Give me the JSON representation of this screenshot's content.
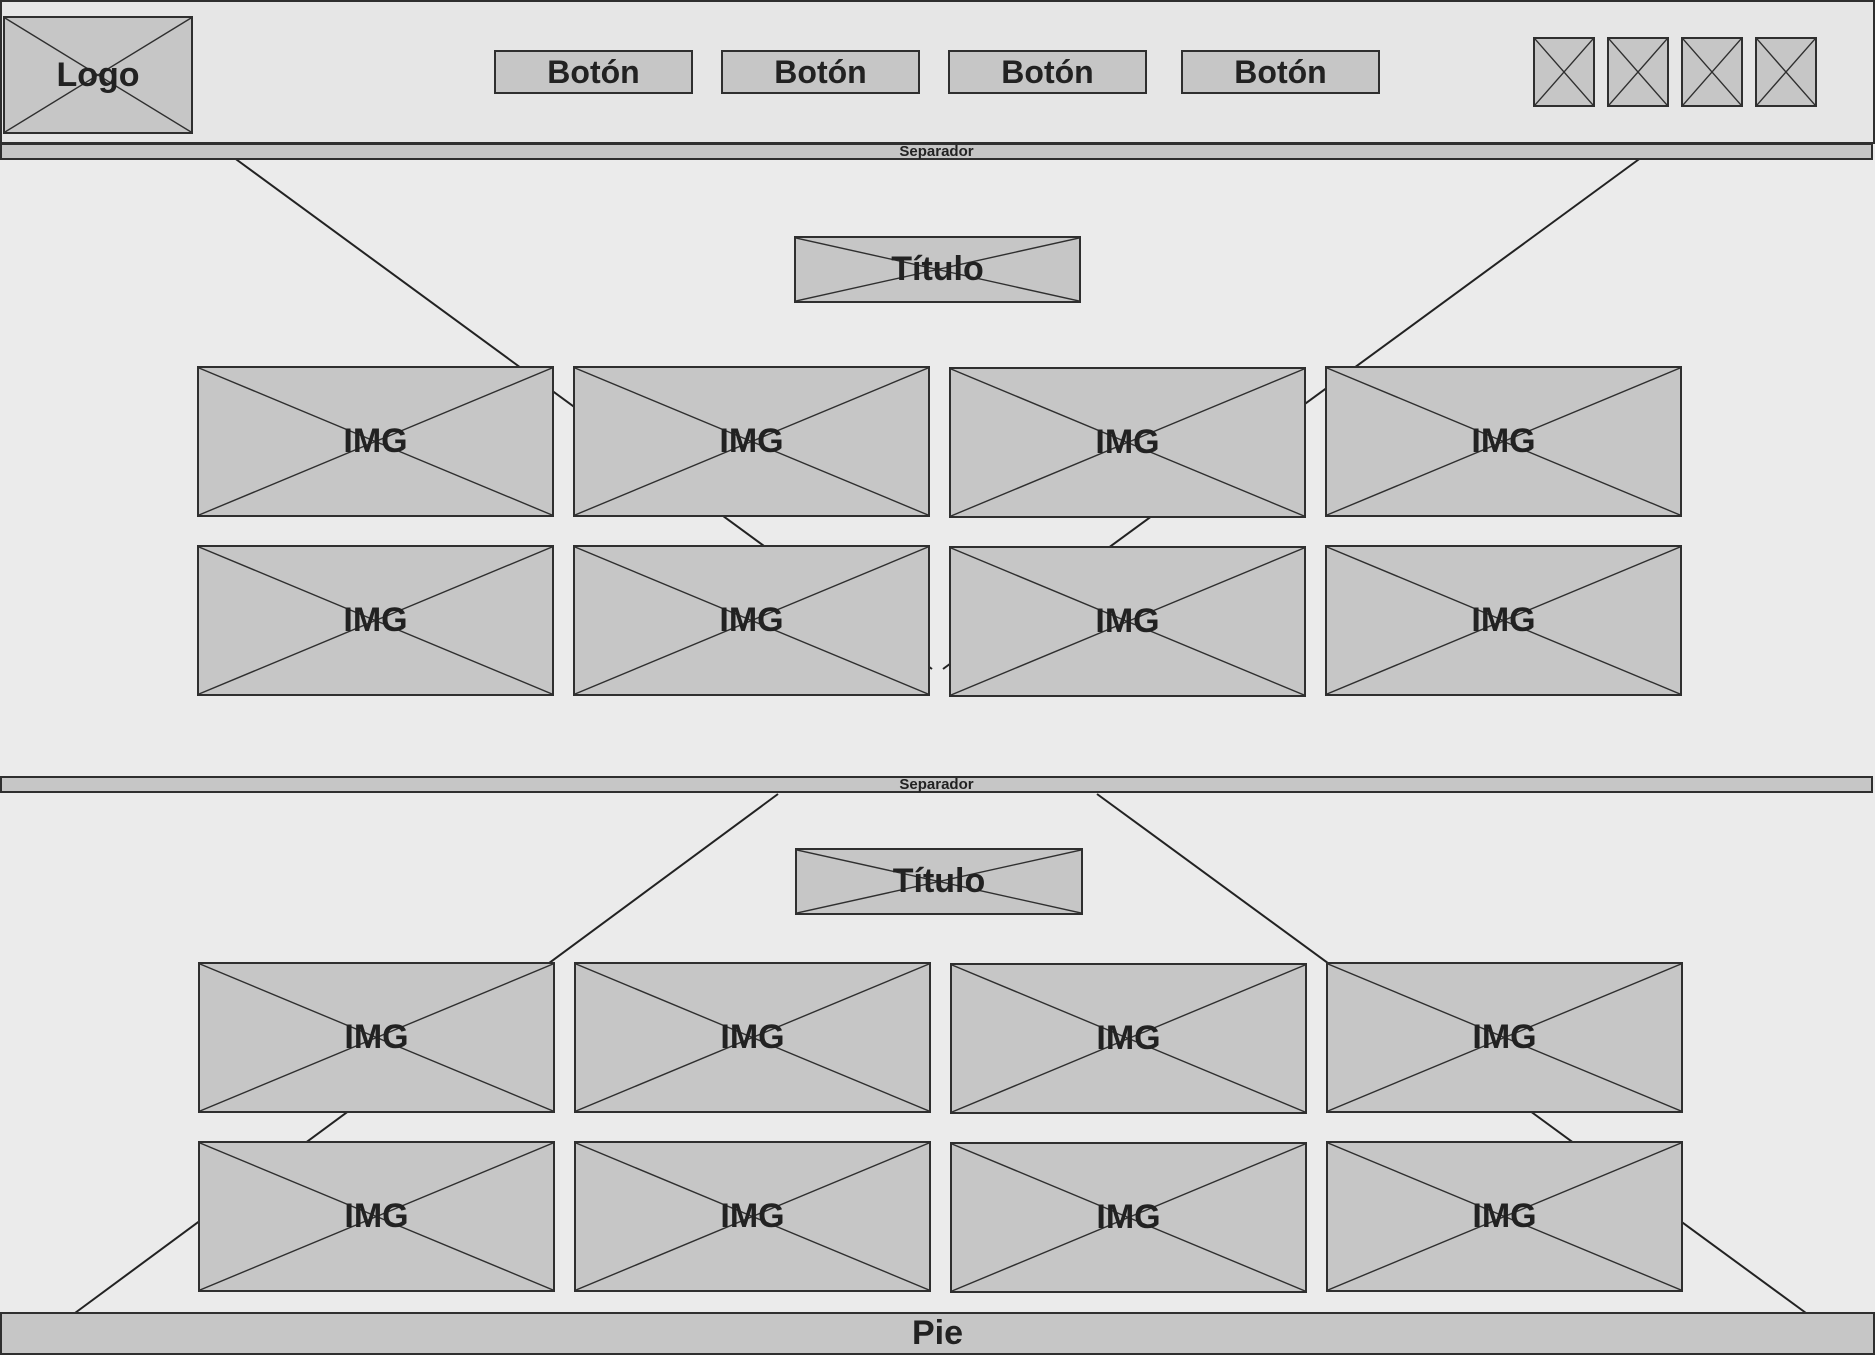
{
  "header": {
    "logo_label": "Logo",
    "nav_buttons": [
      "Botón",
      "Botón",
      "Botón",
      "Botón"
    ]
  },
  "separator_top": "Separador",
  "section1": {
    "title": "Título",
    "images": [
      "IMG",
      "IMG",
      "IMG",
      "IMG",
      "IMG",
      "IMG",
      "IMG",
      "IMG"
    ]
  },
  "separator_middle": "Separador",
  "section2": {
    "title": "Título",
    "images": [
      "IMG",
      "IMG",
      "IMG",
      "IMG",
      "IMG",
      "IMG",
      "IMG",
      "IMG"
    ]
  },
  "footer_label": "Pie",
  "colors": {
    "background": "#ebebeb",
    "placeholder_fill": "#c6c6c6",
    "stroke": "#2f2f2f"
  }
}
